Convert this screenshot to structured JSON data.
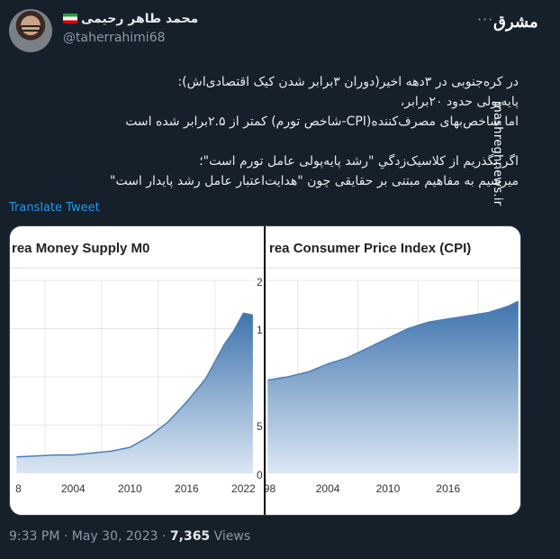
{
  "author": {
    "display_name": "محمد طاهر رحیمی",
    "handle": "@taherrahimi68",
    "flag": "iran-flag-icon"
  },
  "watermark": {
    "logo_text": "مشرق",
    "site": "mashreghnews.ir"
  },
  "tweet": {
    "lines": [
      "در کره‌جنوبی در ۳دهه اخیر(دوران ۳برابر شدن کیک اقتصادی‌اش):",
      "پایه‌پولی حدود ۲۰برابر،",
      "اما شاخص‌بهای مصرف‌کننده(CPI-شاخص تورم) کمتر از ۲.۵برابر شده است",
      "",
      "اگر بگذریم از کلاسیک‌زدگیِ \"رشد پایه‌پولی عامل تورم است\"؛",
      "میرسیم به مفاهیم مبتنی بر حقایقی چون \"هدایت‌اعتبار عامل رشد پایدار است\""
    ],
    "translate_label": "Translate Tweet"
  },
  "footer": {
    "time": "9:33 PM",
    "date": "May 30, 2023",
    "views_count": "7,365",
    "views_label": "Views"
  },
  "chart_data": [
    {
      "type": "area",
      "title": "rea Money Supply M0",
      "x_ticks": [
        "8",
        "2004",
        "2010",
        "2016",
        "2022"
      ],
      "x": [
        1998,
        2000,
        2002,
        2004,
        2006,
        2008,
        2010,
        2012,
        2014,
        2016,
        2018,
        2020,
        2021,
        2022,
        2023
      ],
      "values": [
        0.17,
        0.18,
        0.19,
        0.19,
        0.21,
        0.23,
        0.27,
        0.38,
        0.53,
        0.74,
        0.98,
        1.34,
        1.48,
        1.66,
        1.64
      ],
      "y_ticks": [
        "0",
        "5",
        "1",
        "2"
      ],
      "ylim": [
        0,
        2
      ],
      "grid": true,
      "color": "#4b7fb4"
    },
    {
      "type": "area",
      "title": "rea Consumer Price Index (CPI)",
      "x_ticks": [
        "98",
        "2004",
        "2010",
        "2016"
      ],
      "x": [
        1998,
        2000,
        2002,
        2004,
        2006,
        2008,
        2010,
        2012,
        2014,
        2016,
        2018,
        2020,
        2022,
        2023
      ],
      "values": [
        58,
        60,
        63,
        68,
        72,
        78,
        84,
        90,
        94,
        96,
        98,
        100,
        104,
        107
      ],
      "ylim": [
        0,
        120
      ],
      "grid": true,
      "color": "#4b7fb4"
    }
  ]
}
